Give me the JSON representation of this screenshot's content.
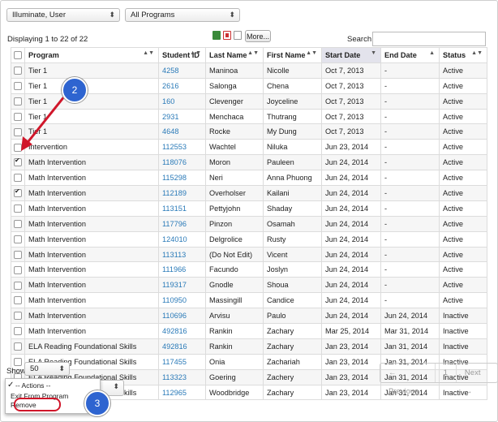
{
  "filters": {
    "user": "Illuminate, User",
    "program": "All Programs"
  },
  "toolbar": {
    "displaying": "Displaying 1 to 22 of 22",
    "more": "More...",
    "search_label": "Search"
  },
  "columns": [
    "Program",
    "Student ID",
    "Last Name",
    "First Name",
    "Start Date",
    "End Date",
    "Status"
  ],
  "rows": [
    {
      "checked": false,
      "program": "Tier 1",
      "id": "4258",
      "last": "Maninoa",
      "first": "Nicolle",
      "start": "Oct 7, 2013",
      "end": "-",
      "status": "Active"
    },
    {
      "checked": false,
      "program": "Tier 1",
      "id": "2616",
      "last": "Salonga",
      "first": "Chena",
      "start": "Oct 7, 2013",
      "end": "-",
      "status": "Active"
    },
    {
      "checked": false,
      "program": "Tier 1",
      "id": "160",
      "last": "Clevenger",
      "first": "Joyceline",
      "start": "Oct 7, 2013",
      "end": "-",
      "status": "Active"
    },
    {
      "checked": false,
      "program": "Tier 1",
      "id": "2931",
      "last": "Menchaca",
      "first": "Thutrang",
      "start": "Oct 7, 2013",
      "end": "-",
      "status": "Active"
    },
    {
      "checked": false,
      "program": "Tier 1",
      "id": "4648",
      "last": "Rocke",
      "first": "My Dung",
      "start": "Oct 7, 2013",
      "end": "-",
      "status": "Active"
    },
    {
      "checked": false,
      "program": "Intervention",
      "id": "112553",
      "last": "Wachtel",
      "first": "Niluka",
      "start": "Jun 23, 2014",
      "end": "-",
      "status": "Active"
    },
    {
      "checked": true,
      "program": "Math Intervention",
      "id": "118076",
      "last": "Moron",
      "first": "Pauleen",
      "start": "Jun 24, 2014",
      "end": "-",
      "status": "Active"
    },
    {
      "checked": false,
      "program": "Math Intervention",
      "id": "115298",
      "last": "Neri",
      "first": "Anna Phuong",
      "start": "Jun 24, 2014",
      "end": "-",
      "status": "Active"
    },
    {
      "checked": true,
      "program": "Math Intervention",
      "id": "112189",
      "last": "Overholser",
      "first": "Kailani",
      "start": "Jun 24, 2014",
      "end": "-",
      "status": "Active"
    },
    {
      "checked": false,
      "program": "Math Intervention",
      "id": "113151",
      "last": "Pettyjohn",
      "first": "Shaday",
      "start": "Jun 24, 2014",
      "end": "-",
      "status": "Active"
    },
    {
      "checked": false,
      "program": "Math Intervention",
      "id": "117796",
      "last": "Pinzon",
      "first": "Osamah",
      "start": "Jun 24, 2014",
      "end": "-",
      "status": "Active"
    },
    {
      "checked": false,
      "program": "Math Intervention",
      "id": "124010",
      "last": "Delgrolice",
      "first": "Rusty",
      "start": "Jun 24, 2014",
      "end": "-",
      "status": "Active"
    },
    {
      "checked": false,
      "program": "Math Intervention",
      "id": "113113",
      "last": "(Do Not Edit)",
      "first": "Vicent",
      "start": "Jun 24, 2014",
      "end": "-",
      "status": "Active"
    },
    {
      "checked": false,
      "program": "Math Intervention",
      "id": "111966",
      "last": "Facundo",
      "first": "Joslyn",
      "start": "Jun 24, 2014",
      "end": "-",
      "status": "Active"
    },
    {
      "checked": false,
      "program": "Math Intervention",
      "id": "119317",
      "last": "Gnodle",
      "first": "Shoua",
      "start": "Jun 24, 2014",
      "end": "-",
      "status": "Active"
    },
    {
      "checked": false,
      "program": "Math Intervention",
      "id": "110950",
      "last": "Massingill",
      "first": "Candice",
      "start": "Jun 24, 2014",
      "end": "-",
      "status": "Active"
    },
    {
      "checked": false,
      "program": "Math Intervention",
      "id": "110696",
      "last": "Arvisu",
      "first": "Paulo",
      "start": "Jun 24, 2014",
      "end": "Jun 24, 2014",
      "status": "Inactive"
    },
    {
      "checked": false,
      "program": "Math Intervention",
      "id": "492816",
      "last": "Rankin",
      "first": "Zachary",
      "start": "Mar 25, 2014",
      "end": "Mar 31, 2014",
      "status": "Inactive"
    },
    {
      "checked": false,
      "program": "ELA Reading Foundational Skills",
      "id": "492816",
      "last": "Rankin",
      "first": "Zachary",
      "start": "Jan 23, 2014",
      "end": "Jan 31, 2014",
      "status": "Inactive"
    },
    {
      "checked": false,
      "program": "ELA Reading Foundational Skills",
      "id": "117455",
      "last": "Onia",
      "first": "Zachariah",
      "start": "Jan 23, 2014",
      "end": "Jan 31, 2014",
      "status": "Inactive"
    },
    {
      "checked": false,
      "program": "ELA Reading Foundational Skills",
      "id": "113323",
      "last": "Goering",
      "first": "Zachery",
      "start": "Jan 23, 2014",
      "end": "Jan 31, 2014",
      "status": "Inactive"
    },
    {
      "checked": false,
      "program": "ELA Reading Foundational Skills",
      "id": "112965",
      "last": "Woodbridge",
      "first": "Zachary",
      "start": "Jan 23, 2014",
      "end": "Jan 31, 2014",
      "status": "Inactive"
    }
  ],
  "footer": {
    "show_label": "Show",
    "page_size": "50",
    "prev": "← Previous",
    "page": "1",
    "next": "Next →"
  },
  "actions_menu": {
    "check": "✓",
    "header": "-- Actions --",
    "items": [
      "Exit From Program",
      "Remove"
    ]
  },
  "callouts": {
    "step2": "2",
    "step3": "3"
  },
  "colors": {
    "link": "#2a7ab8",
    "callout": "#2e64d0",
    "highlight": "#d0162a"
  }
}
